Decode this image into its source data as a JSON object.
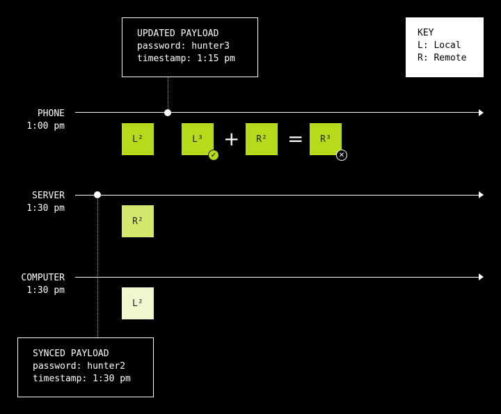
{
  "colors": {
    "phone_tile": "#b5db1b",
    "server_tile": "#d4e86e",
    "computer_tile": "#f0f7d0"
  },
  "updated_payload": {
    "title": "UPDATED PAYLOAD",
    "line1": "password: hunter3",
    "line2": "timestamp: 1:15 pm"
  },
  "key": {
    "title": "KEY",
    "line1": "L: Local",
    "line2": "R: Remote"
  },
  "phone": {
    "name": "PHONE",
    "time": "1:00 pm",
    "tiles": [
      "L²",
      "L³",
      "R²",
      "R³"
    ],
    "plus": "+",
    "equals": "="
  },
  "server": {
    "name": "SERVER",
    "time": "1:30 pm",
    "tile": "R²"
  },
  "computer": {
    "name": "COMPUTER",
    "time": "1:30 pm",
    "tile": "L²"
  },
  "synced_payload": {
    "title": "SYNCED PAYLOAD",
    "line1": "password: hunter2",
    "line2": "timestamp: 1:30 pm"
  },
  "icons": {
    "success": "check-circle-icon",
    "failure": "x-circle-icon"
  }
}
